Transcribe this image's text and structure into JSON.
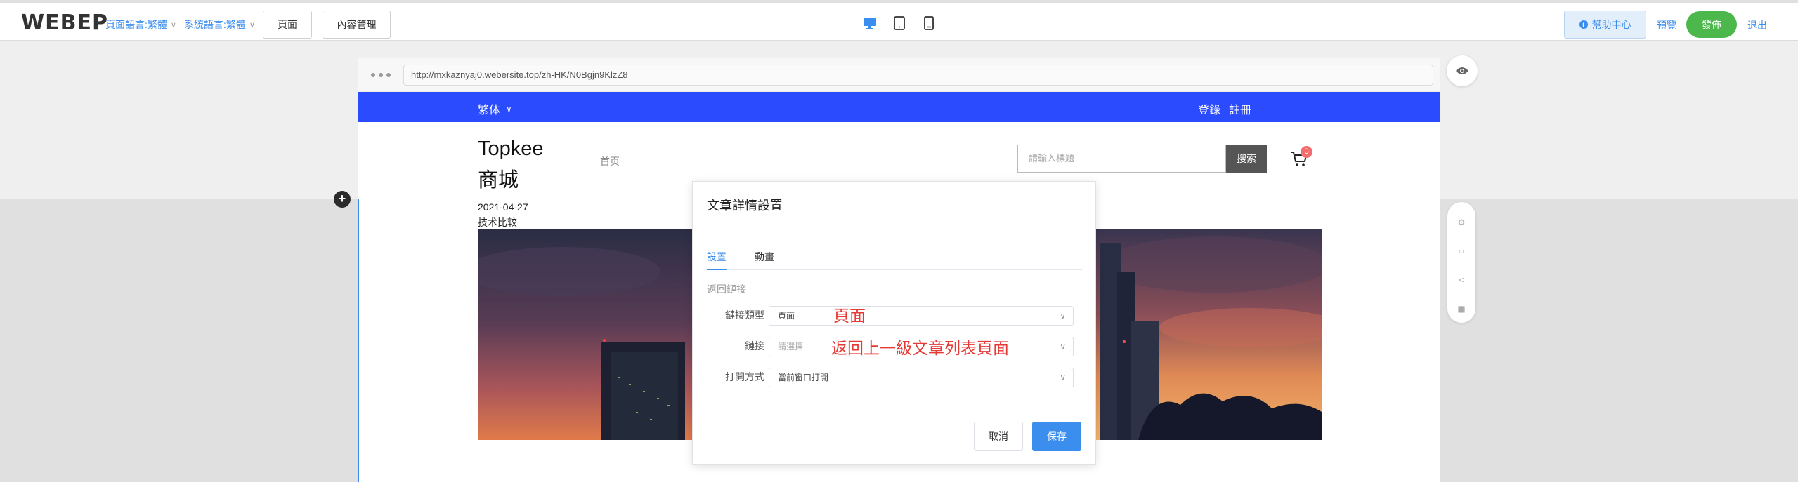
{
  "header": {
    "logo_text": "WEBEP",
    "page_language": "頁面語言:繁體",
    "system_language": "系統語言:繁體",
    "page_button": "頁面",
    "content_button": "內容管理",
    "devices": [
      "desktop-icon",
      "tablet-icon",
      "mobile-icon"
    ],
    "help": "幫助中心",
    "preview": "預覽",
    "publish": "發佈",
    "logout": "退出"
  },
  "browser": {
    "url": "http://mxkaznyaj0.webersite.top/zh-HK/N0Bgjn9KlzZ8"
  },
  "site": {
    "language": "繁体",
    "login": "登錄",
    "register": "註冊",
    "brand_line1": "Topkee",
    "brand_line2": "商城",
    "home": "首页",
    "search_placeholder": "請輸入標題",
    "search_button": "搜索",
    "cart_count": "0",
    "article_date": "2021-04-27",
    "article_category": "技术比较"
  },
  "dialog": {
    "title": "文章詳情設置",
    "tabs": [
      "設置",
      "動畫"
    ],
    "section": "返回鏈接",
    "fields": [
      {
        "label": "鏈接類型",
        "value": "頁面",
        "placeholder": false
      },
      {
        "label": "鏈接",
        "value": "請選擇",
        "placeholder": true
      },
      {
        "label": "打開方式",
        "value": "當前窗口打開",
        "placeholder": false
      }
    ],
    "annotation_1": "頁面",
    "annotation_2": "返回上一級文章列表頁面",
    "cancel": "取消",
    "save": "保存"
  },
  "colors": {
    "accent": "#3b8dee",
    "site_nav": "#2b4bff",
    "publish": "#4cb84c",
    "annotation": "#e53935"
  }
}
